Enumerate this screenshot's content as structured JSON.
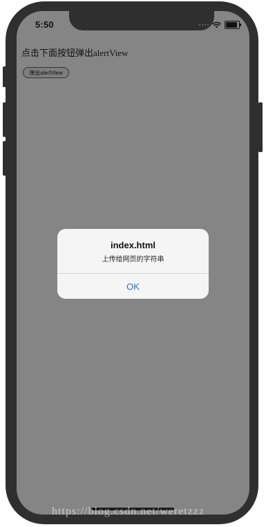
{
  "status_bar": {
    "time": "5:50",
    "wifi_icon": "wifi-icon",
    "battery_icon": "battery-icon",
    "battery_level": 0.9
  },
  "page": {
    "instruction_text": "点击下面按钮弹出alertView",
    "popup_button_label": "弹出alertView"
  },
  "alert": {
    "title": "index.html",
    "message": "上传给网页的字符串",
    "ok_label": "OK"
  },
  "watermark": "https://blog.csdn.net/weretzzz",
  "colors": {
    "screen_background": "#858585",
    "frame": "#2f2f2f",
    "alert_background": "#f5f5f5",
    "ok_text": "#1a73d9"
  }
}
